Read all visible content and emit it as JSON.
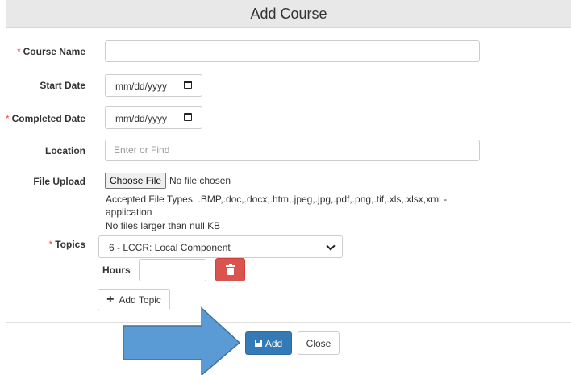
{
  "dialog": {
    "title": "Add Course"
  },
  "fields": {
    "course_name": {
      "label": "Course Name",
      "required_mark": "*",
      "value": ""
    },
    "start_date": {
      "label": "Start Date",
      "value": "mm/dd/yyyy",
      "icon": "calendar-icon"
    },
    "completed_date": {
      "label": "Completed Date",
      "required_mark": "*",
      "value": "mm/dd/yyyy",
      "icon": "calendar-icon"
    },
    "location": {
      "label": "Location",
      "placeholder": "Enter or Find"
    },
    "file_upload": {
      "label": "File Upload",
      "button_label": "Choose File",
      "status": "No file chosen",
      "accepted_line1": "Accepted File Types: .BMP,.doc,.docx,.htm,.jpeg,.jpg,.pdf,.png,.tif,.xls,.xlsx,xml -",
      "accepted_line2": "application",
      "size_limit": "No files larger than null KB"
    },
    "topics": {
      "label": "Topics",
      "required_mark": "*",
      "selected": "6 - LCCR: Local Component",
      "hours_label": "Hours",
      "hours_value": "",
      "delete_icon": "trash-icon",
      "add_topic_label": "Add Topic",
      "add_icon": "plus-icon"
    }
  },
  "footer": {
    "add_label": "Add",
    "add_icon": "save-icon",
    "close_label": "Close"
  },
  "colors": {
    "required": "#d9534f",
    "primary": "#337ab7",
    "danger": "#d9534f",
    "arrow_fill": "#5b9bd5",
    "arrow_stroke": "#41719c"
  }
}
